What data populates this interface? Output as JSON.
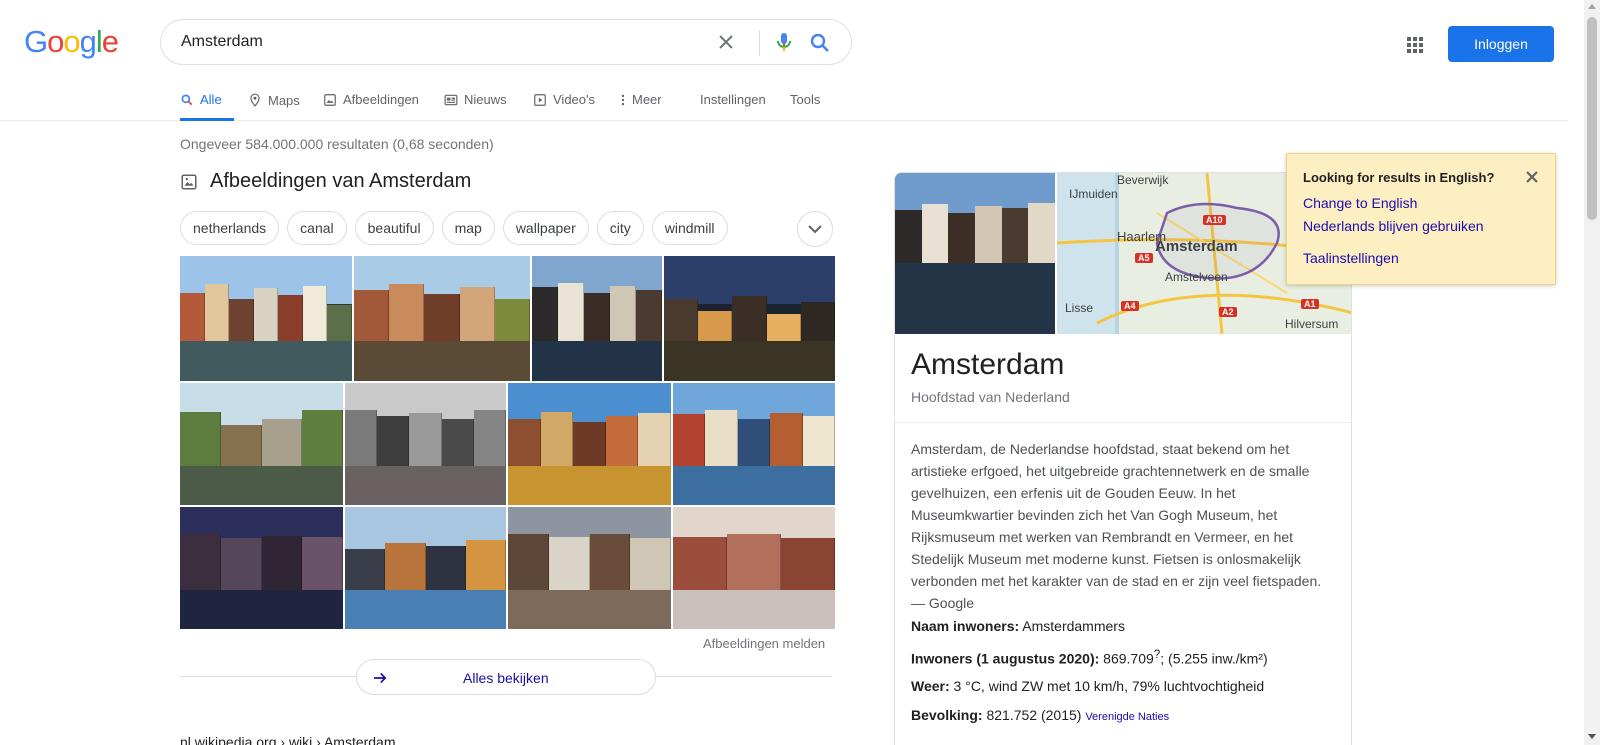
{
  "header": {
    "logo_letters": [
      "G",
      "o",
      "o",
      "g",
      "l",
      "e"
    ],
    "logo_colors": [
      "#4285f4",
      "#ea4335",
      "#fbbc05",
      "#4285f4",
      "#34a853",
      "#ea4335"
    ],
    "search_query": "Amsterdam",
    "signin_label": "Inloggen",
    "accent_color": "#1a73e8"
  },
  "tabs": [
    {
      "label": "Alle",
      "icon": "search-icon",
      "active": true
    },
    {
      "label": "Maps",
      "icon": "map-pin-icon"
    },
    {
      "label": "Afbeeldingen",
      "icon": "image-icon"
    },
    {
      "label": "Nieuws",
      "icon": "news-icon"
    },
    {
      "label": "Video's",
      "icon": "video-icon"
    },
    {
      "label": "Meer",
      "icon": "more-vert-icon"
    },
    {
      "label": "Instellingen"
    },
    {
      "label": "Tools"
    }
  ],
  "results": {
    "stats": "Ongeveer 584.000.000 resultaten (0,68 seconden)",
    "images_heading": "Afbeeldingen van Amsterdam",
    "chips": [
      "netherlands",
      "canal",
      "beautiful",
      "map",
      "wallpaper",
      "city",
      "windmill"
    ],
    "report_images": "Afbeeldingen melden",
    "see_all": "Alles bekijken",
    "first_result_cite": "nl.wikipedia.org › wiki › Amsterdam"
  },
  "knowledge_panel": {
    "title": "Amsterdam",
    "subtitle": "Hoofdstad van Nederland",
    "description": "Amsterdam, de Nederlandse hoofdstad, staat bekend om het artistieke erfgoed, het uitgebreide grachtennetwerk en de smalle gevelhuizen, een erfenis uit de Gouden Eeuw. In het Museumkwartier bevinden zich het Van Gogh Museum, het Rijksmuseum met werken van Rembrandt en Vermeer, en het Stedelijk Museum met moderne kunst. Fietsen is onlosmakelijk verbonden met het karakter van de stad en er zijn veel fietspaden.",
    "description_source": "— Google",
    "map_labels": {
      "beverwijk": "Beverwijk",
      "ijmuiden": "IJmuiden",
      "haarlem": "Haarlem",
      "amsterdam": "Amsterdam",
      "amstelveen": "Amstelveen",
      "lisse": "Lisse",
      "hilversum": "Hilversum",
      "a10": "A10",
      "a5": "A5",
      "a4": "A4",
      "a2": "A2",
      "a1": "A1"
    },
    "facts": {
      "naam_label": "Naam inwoners:",
      "naam_value": "Amsterdammers",
      "inwoners_label": "Inwoners (1 augustus 2020):",
      "inwoners_value": "869.709",
      "inwoners_sup": "?",
      "inwoners_density": "; (5.255 inw./km²)",
      "weer_label": "Weer:",
      "weer_value": "3 °C, wind ZW met 10 km/h, 79% luchtvochtigheid",
      "bevolking_label": "Bevolking:",
      "bevolking_value": "821.752 (2015)",
      "bevolking_source": "Verenigde Naties"
    }
  },
  "language_popup": {
    "title": "Looking for results in English?",
    "change_link": "Change to English",
    "keep_link": "Nederlands blijven gebruiken",
    "settings_link": "Taalinstellingen",
    "background": "#feefc3"
  }
}
